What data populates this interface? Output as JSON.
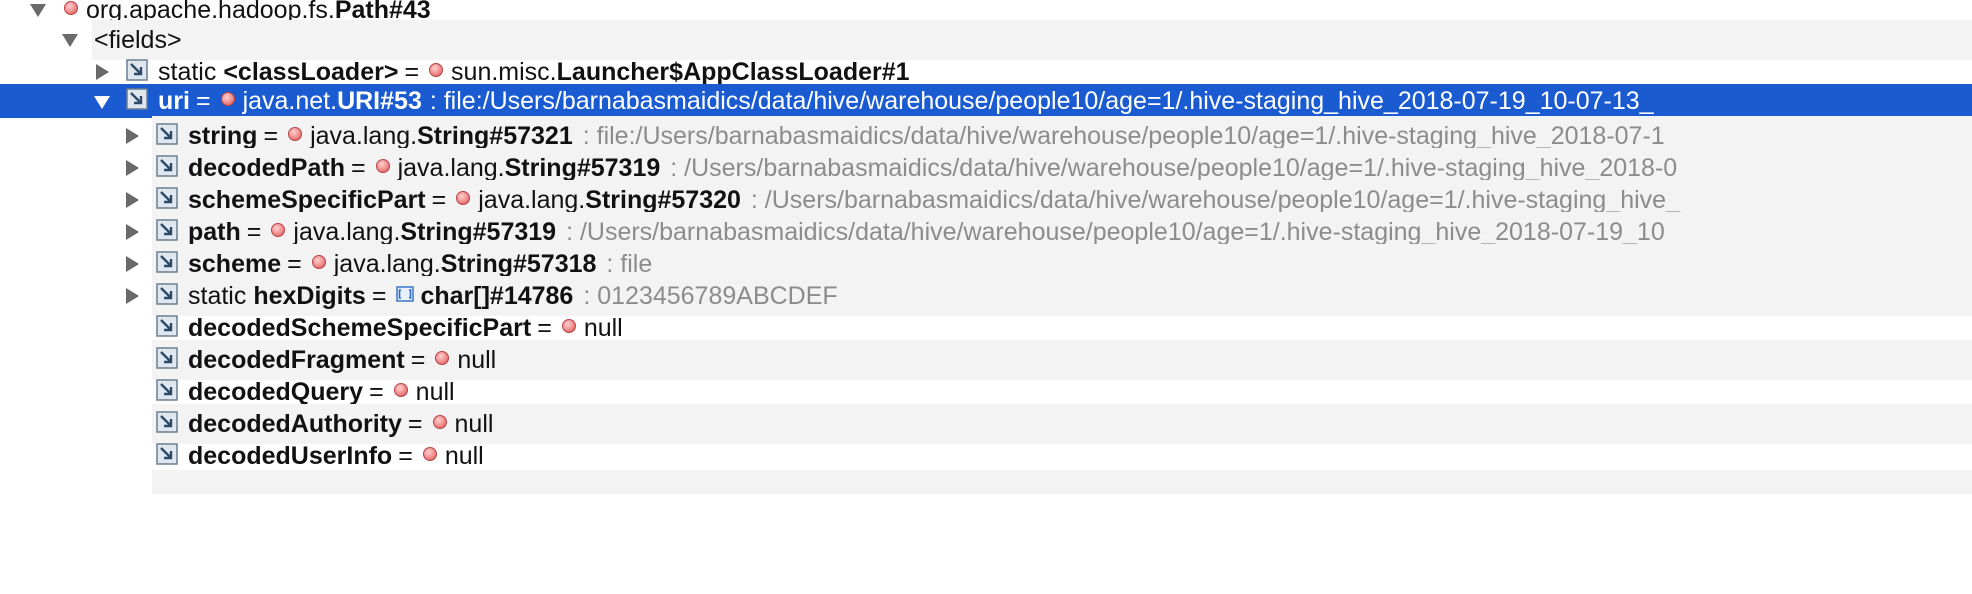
{
  "tree": {
    "root": {
      "type_prefix": "org.apache.hadoop.fs.",
      "type_name": "Path#43"
    },
    "fields_node": "<fields>",
    "classloader": {
      "modifier": "static",
      "name": "<classLoader>",
      "eq": "=",
      "type_prefix": "sun.misc.",
      "type_name": "Launcher$AppClassLoader#1"
    },
    "uri": {
      "name": "uri",
      "eq": "=",
      "type_prefix": "java.net.",
      "type_name": "URI#53",
      "value": ": file:/Users/barnabasmaidics/data/hive/warehouse/people10/age=1/.hive-staging_hive_2018-07-19_10-07-13_"
    },
    "children": [
      {
        "name": "string",
        "eq": "=",
        "type_prefix": "java.lang.",
        "type_name": "String#57321",
        "value": ": file:/Users/barnabasmaidics/data/hive/warehouse/people10/age=1/.hive-staging_hive_2018-07-1"
      },
      {
        "name": "decodedPath",
        "eq": "=",
        "type_prefix": "java.lang.",
        "type_name": "String#57319",
        "value": ": /Users/barnabasmaidics/data/hive/warehouse/people10/age=1/.hive-staging_hive_2018-0"
      },
      {
        "name": "schemeSpecificPart",
        "eq": "=",
        "type_prefix": "java.lang.",
        "type_name": "String#57320",
        "value": ": /Users/barnabasmaidics/data/hive/warehouse/people10/age=1/.hive-staging_hive_"
      },
      {
        "name": "path",
        "eq": "=",
        "type_prefix": "java.lang.",
        "type_name": "String#57319",
        "value": ": /Users/barnabasmaidics/data/hive/warehouse/people10/age=1/.hive-staging_hive_2018-07-19_10"
      },
      {
        "name": "scheme",
        "eq": "=",
        "type_prefix": "java.lang.",
        "type_name": "String#57318",
        "value": ": file"
      }
    ],
    "hexdigits": {
      "modifier": "static",
      "name": "hexDigits",
      "eq": "=",
      "type_name": "char[]#14786",
      "value": ": 0123456789ABCDEF"
    },
    "nulls": [
      {
        "name": "decodedSchemeSpecificPart",
        "eq": "=",
        "value": "null"
      },
      {
        "name": "decodedFragment",
        "eq": "=",
        "value": "null"
      },
      {
        "name": "decodedQuery",
        "eq": "=",
        "value": "null"
      },
      {
        "name": "decodedAuthority",
        "eq": "=",
        "value": "null"
      },
      {
        "name": "decodedUserInfo",
        "eq": "=",
        "value": "null"
      }
    ]
  },
  "colors": {
    "selection": "#1a5bd1",
    "stripe": "#f3f3f3",
    "value_text": "#8c8c8c",
    "object_dot": "#e57373"
  },
  "icons": {
    "expanded": "triangle-down-icon",
    "collapsed": "triangle-right-icon",
    "object": "object-instance-icon",
    "field": "field-reference-icon",
    "array": "array-icon"
  }
}
